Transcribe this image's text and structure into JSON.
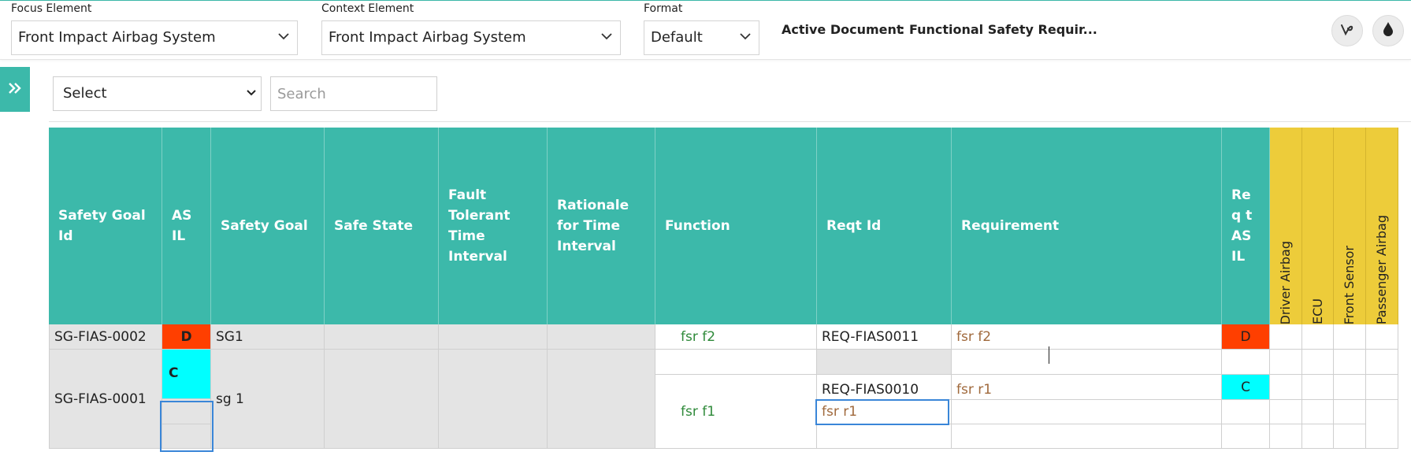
{
  "toolbar": {
    "focus_label": "Focus Element",
    "focus_value": "Front Impact Airbag System",
    "context_label": "Context Element",
    "context_value": "Front Impact Airbag System",
    "format_label": "Format",
    "format_value": "Default",
    "active_doc_label": "Active Document",
    "active_doc_value": ": Functional Safety Requir..."
  },
  "filters": {
    "select_value": "Select",
    "search_placeholder": "Search"
  },
  "table": {
    "headers": {
      "safety_goal_id": "Safety Goal Id",
      "asil": "ASIL",
      "safety_goal": "Safety Goal",
      "safe_state": "Safe State",
      "ftti": "Fault Tolerant Time Interval",
      "rationale": "Rationale for Time Interval",
      "function": "Function",
      "reqt_id": "Reqt Id",
      "requirement": "Requirement",
      "reqt_asil": "Req t ASIL",
      "driver_airbag": "Driver Airbag",
      "ecu": "ECU",
      "front_sensor": "Front Sensor",
      "passenger_airbag": "Passenger Airbag"
    },
    "rows": [
      {
        "safety_goal_id": "SG-FIAS-0002",
        "asil": "D",
        "safety_goal": "SG1",
        "function": "fsr f2",
        "reqt_id": "REQ-FIAS0011",
        "requirement": "fsr f2",
        "reqt_asil": "D"
      },
      {
        "safety_goal_id": "SG-FIAS-0001",
        "asil": "C",
        "safety_goal": "sg 1",
        "function": "fsr f1",
        "reqt_id_1": "REQ-FIAS0010",
        "requirement_1": "fsr r1",
        "reqt_asil_1": "C",
        "reqt_id_2": "fsr r1"
      }
    ]
  },
  "colors": {
    "teal": "#3cb9aa",
    "yellow": "#edcc3a",
    "asil_d": "#ff3f00",
    "asil_c": "#00ffff",
    "selection": "#3a86d8"
  }
}
